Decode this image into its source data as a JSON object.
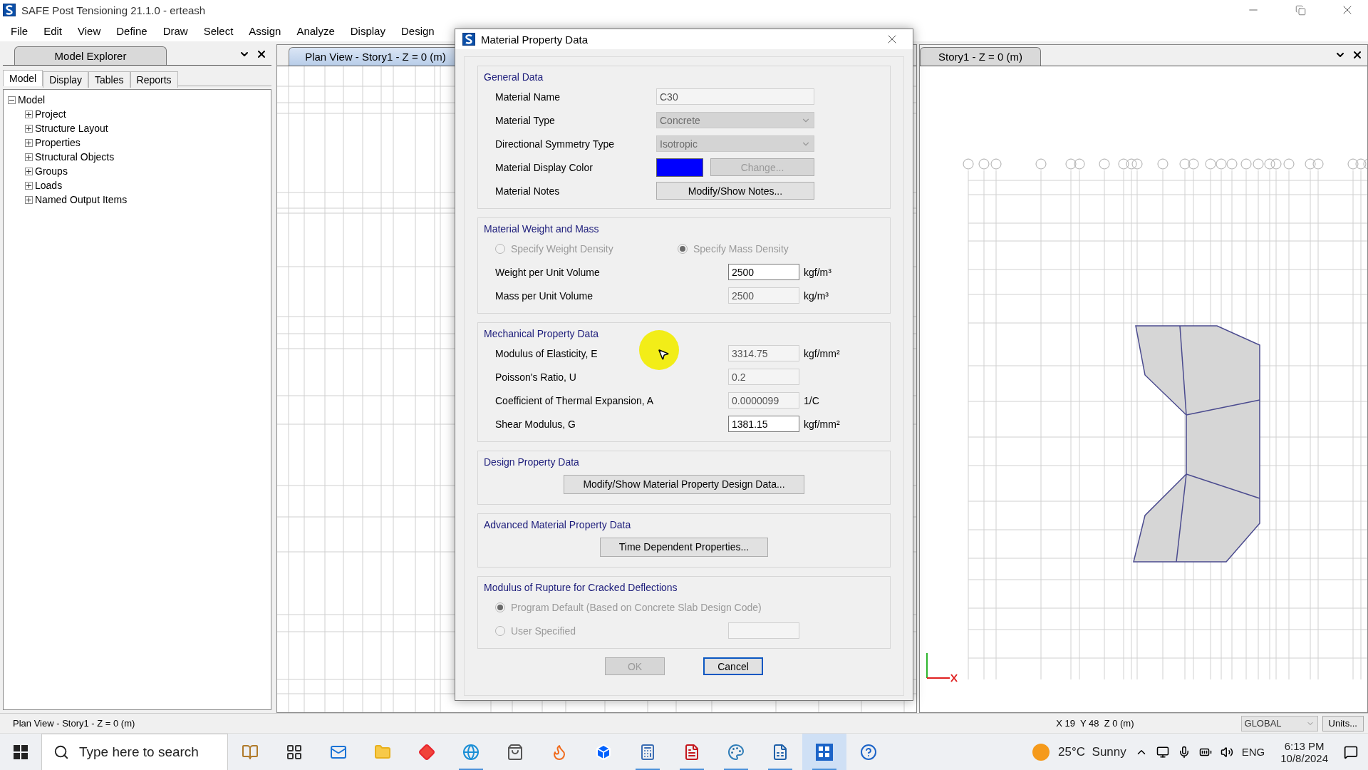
{
  "app": {
    "title": "SAFE Post Tensioning 21.1.0 - erteash"
  },
  "menu": [
    "File",
    "Edit",
    "View",
    "Define",
    "Draw",
    "Select",
    "Assign",
    "Analyze",
    "Display",
    "Design"
  ],
  "model_explorer": {
    "title": "Model Explorer",
    "tabs": [
      {
        "label": "Model",
        "selected": true
      },
      {
        "label": "Display",
        "selected": false
      },
      {
        "label": "Tables",
        "selected": false
      },
      {
        "label": "Reports",
        "selected": false
      }
    ],
    "tree": [
      {
        "label": "Model",
        "expanded": true,
        "children": [
          {
            "label": "Project",
            "expanded": false
          },
          {
            "label": "Structure Layout",
            "expanded": false
          },
          {
            "label": "Properties",
            "expanded": false
          },
          {
            "label": "Structural Objects",
            "expanded": false
          },
          {
            "label": "Groups",
            "expanded": false
          },
          {
            "label": "Loads",
            "expanded": false
          },
          {
            "label": "Named Output Items",
            "expanded": false
          }
        ]
      }
    ]
  },
  "views": [
    {
      "title": "Plan View - Story1 - Z = 0 (m)",
      "selected": true
    },
    {
      "title": "Story1 - Z = 0 (m)",
      "selected": false
    }
  ],
  "dialog": {
    "title": "Material Property Data",
    "sections": [
      {
        "title": "General Data",
        "rows": [
          {
            "kind": "text",
            "label": "Material Name",
            "value": "C30",
            "disabled": true
          },
          {
            "kind": "select",
            "label": "Material Type",
            "value": "Concrete",
            "disabled": true
          },
          {
            "kind": "select",
            "label": "Directional Symmetry Type",
            "value": "Isotropic",
            "disabled": true
          },
          {
            "kind": "color",
            "label": "Material Display Color",
            "color": "#0000ff",
            "button": "Change...",
            "disabled": true
          },
          {
            "kind": "button",
            "label": "Material Notes",
            "button": "Modify/Show Notes...",
            "disabled": false
          }
        ]
      },
      {
        "title": "Material Weight and Mass",
        "rows": [
          {
            "kind": "radios",
            "disabled": true,
            "options": [
              {
                "label": "Specify Weight Density",
                "selected": false
              },
              {
                "label": "Specify Mass Density",
                "selected": true
              }
            ]
          },
          {
            "kind": "number",
            "label": "Weight per Unit Volume",
            "value": "2500",
            "unit": "kgf/m³",
            "disabled": false
          },
          {
            "kind": "number",
            "label": "Mass per Unit Volume",
            "value": "2500",
            "unit": "kg/m³",
            "disabled": true
          }
        ]
      },
      {
        "title": "Mechanical Property Data",
        "rows": [
          {
            "kind": "number",
            "label": "Modulus of Elasticity,  E",
            "value": "3314.75",
            "unit": "kgf/mm²",
            "disabled": true
          },
          {
            "kind": "number",
            "label": "Poisson's Ratio,  U",
            "value": "0.2",
            "disabled": true
          },
          {
            "kind": "number",
            "label": "Coefficient of Thermal Expansion,  A",
            "value": "0.0000099",
            "unit": "1/C",
            "disabled": true
          },
          {
            "kind": "number",
            "label": "Shear Modulus,  G",
            "value": "1381.15",
            "unit": "kgf/mm²",
            "disabled": false
          }
        ]
      },
      {
        "title": "Design Property Data",
        "rows": [
          {
            "kind": "wide_button",
            "button": "Modify/Show Material Property Design Data...",
            "disabled": false
          }
        ]
      },
      {
        "title": "Advanced Material Property Data",
        "rows": [
          {
            "kind": "wide_button",
            "button": "Time Dependent Properties...",
            "disabled": false
          }
        ]
      },
      {
        "title": "Modulus of Rupture for Cracked Deflections",
        "rows": [
          {
            "kind": "radio_row",
            "label": "Program Default  (Based on Concrete Slab Design Code)",
            "selected": true,
            "disabled": true
          },
          {
            "kind": "radio_row",
            "label": "User Specified",
            "selected": false,
            "disabled": true,
            "field": true
          }
        ]
      }
    ],
    "buttons": [
      {
        "label": "OK",
        "disabled": true,
        "focused": false
      },
      {
        "label": "Cancel",
        "disabled": false,
        "focused": true
      }
    ]
  },
  "status_bar": {
    "view": "Plan View - Story1 - Z = 0 (m)",
    "coordinates": "X 19  Y 48  Z 0 (m)",
    "coordinate_system": "GLOBAL",
    "units_button": "Units..."
  },
  "taskbar": {
    "search_placeholder": "Type here to search",
    "apps": [
      {
        "kind": "widgets",
        "selected": false,
        "running": false
      },
      {
        "kind": "task_view",
        "selected": false,
        "running": false
      },
      {
        "kind": "mail",
        "selected": false,
        "running": false
      },
      {
        "kind": "folder",
        "selected": false,
        "running": false
      },
      {
        "kind": "diamond",
        "selected": false,
        "running": false
      },
      {
        "kind": "browser",
        "selected": false,
        "running": true
      },
      {
        "kind": "store",
        "selected": false,
        "running": false
      },
      {
        "kind": "firefox",
        "selected": false,
        "running": false
      },
      {
        "kind": "dropbox",
        "selected": false,
        "running": false
      },
      {
        "kind": "calculator",
        "selected": false,
        "running": true
      },
      {
        "kind": "pdf",
        "selected": false,
        "running": true
      },
      {
        "kind": "paint",
        "selected": false,
        "running": true
      },
      {
        "kind": "spreadsheet",
        "selected": false,
        "running": true
      },
      {
        "kind": "safe",
        "selected": true,
        "running": true
      },
      {
        "kind": "help",
        "selected": false,
        "running": false
      }
    ],
    "weather": "25°C  Sunny",
    "language": "ENG",
    "time": "6:13 PM",
    "date": "10/8/2024"
  }
}
